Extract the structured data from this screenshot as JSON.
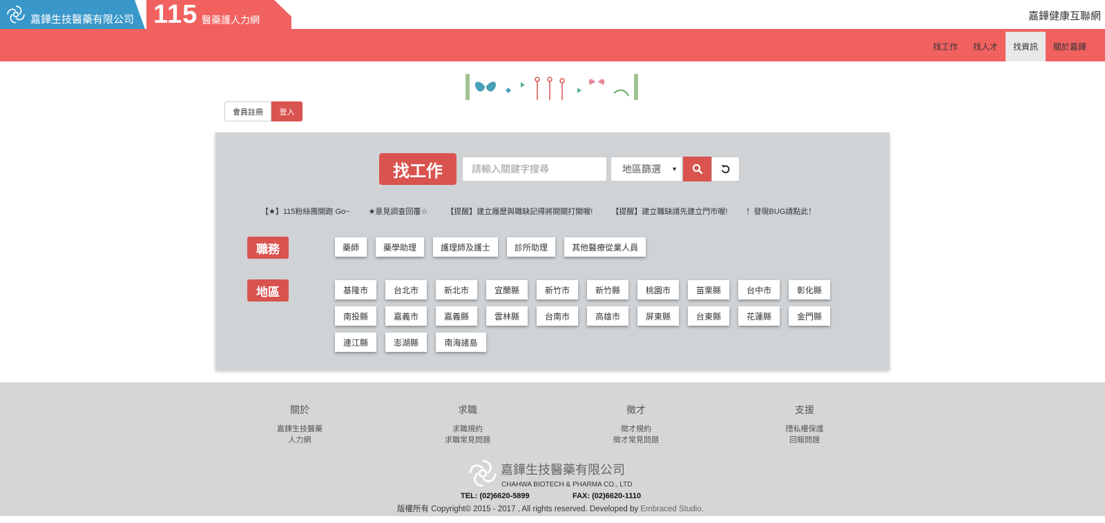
{
  "header": {
    "company_name": "嘉鏵生技醫藥有限公司",
    "brand_number": "115",
    "brand_sub": "醫藥護人力網",
    "right_link": "嘉鏵健康互聯網"
  },
  "nav": {
    "items": [
      {
        "label": "找工作"
      },
      {
        "label": "找人才"
      },
      {
        "label": "找資訊",
        "active": true
      },
      {
        "label": "關於嘉鏵"
      }
    ]
  },
  "auth": {
    "register": "會員註冊",
    "login": "登入"
  },
  "search": {
    "title": "找工作",
    "placeholder": "請輸入關鍵字搜尋",
    "region_select": "地區篩選"
  },
  "notices": [
    "【★】115粉絲團開跑 Go~",
    "★意見調查回覆☆",
    "【提醒】建立履歷與職缺記得將開關打開喔!",
    "【提醒】建立職缺請先建立門市喔!",
    "！發現BUG請點此！"
  ],
  "categories": {
    "job": {
      "label": "職務",
      "items": [
        "藥師",
        "藥學助理",
        "護理師及護士",
        "診所助理",
        "其他醫療從業人員"
      ]
    },
    "region": {
      "label": "地區",
      "items": [
        "基隆市",
        "台北市",
        "新北市",
        "宜蘭縣",
        "新竹市",
        "新竹縣",
        "桃園市",
        "苗栗縣",
        "台中市",
        "彰化縣",
        "南投縣",
        "嘉義市",
        "嘉義縣",
        "雲林縣",
        "台南市",
        "高雄市",
        "屏東縣",
        "台東縣",
        "花蓮縣",
        "金門縣",
        "連江縣",
        "澎湖縣",
        "南海諸島"
      ]
    }
  },
  "footer": {
    "columns": [
      {
        "heading": "關於",
        "links": [
          "嘉鏵生技醫藥",
          "人力網"
        ]
      },
      {
        "heading": "求職",
        "links": [
          "求職規約",
          "求職常見問題"
        ]
      },
      {
        "heading": "徵才",
        "links": [
          "徵才規約",
          "徵才常見問題"
        ]
      },
      {
        "heading": "支援",
        "links": [
          "隱私權保護",
          "回報問題"
        ]
      }
    ],
    "company": "嘉鏵生技醫藥有限公司",
    "company_en": "CHAHWA BIOTECH & PHARMA CO., LTD",
    "tel": "TEL: (02)6620-5899",
    "fax": "FAX: (02)6620-1110",
    "copyright": "版權所有 Copyright© 2015 - 2017 , All rights reserved. Developed by",
    "developer": "Embraced Studio."
  },
  "colors": {
    "brand_blue": "#3a97c9",
    "brand_red": "#f06160",
    "accent_red": "#d9534f",
    "panel_gray": "#cfd3d6",
    "footer_gray": "#d6d6d6"
  }
}
